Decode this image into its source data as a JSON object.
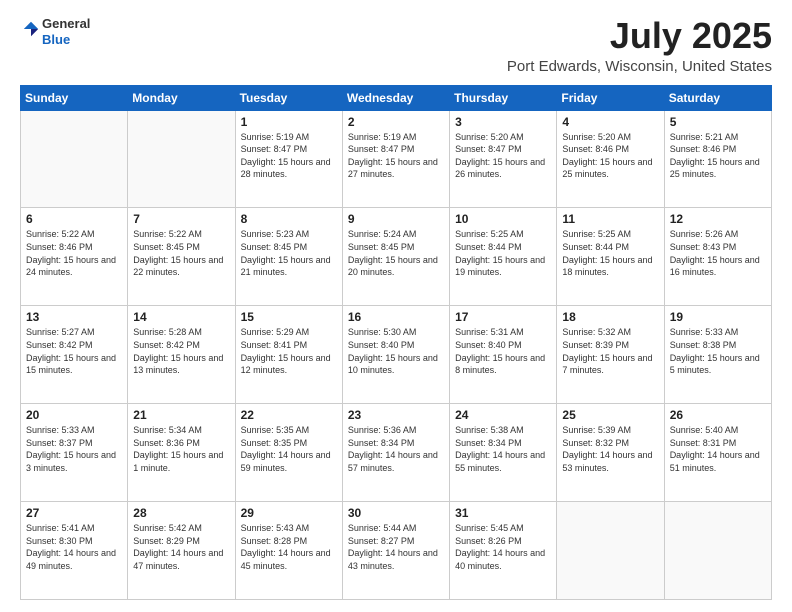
{
  "header": {
    "logo_line1": "General",
    "logo_line2": "Blue",
    "title": "July 2025",
    "subtitle": "Port Edwards, Wisconsin, United States"
  },
  "days_of_week": [
    "Sunday",
    "Monday",
    "Tuesday",
    "Wednesday",
    "Thursday",
    "Friday",
    "Saturday"
  ],
  "weeks": [
    [
      {
        "num": "",
        "info": ""
      },
      {
        "num": "",
        "info": ""
      },
      {
        "num": "1",
        "info": "Sunrise: 5:19 AM\nSunset: 8:47 PM\nDaylight: 15 hours and 28 minutes."
      },
      {
        "num": "2",
        "info": "Sunrise: 5:19 AM\nSunset: 8:47 PM\nDaylight: 15 hours and 27 minutes."
      },
      {
        "num": "3",
        "info": "Sunrise: 5:20 AM\nSunset: 8:47 PM\nDaylight: 15 hours and 26 minutes."
      },
      {
        "num": "4",
        "info": "Sunrise: 5:20 AM\nSunset: 8:46 PM\nDaylight: 15 hours and 25 minutes."
      },
      {
        "num": "5",
        "info": "Sunrise: 5:21 AM\nSunset: 8:46 PM\nDaylight: 15 hours and 25 minutes."
      }
    ],
    [
      {
        "num": "6",
        "info": "Sunrise: 5:22 AM\nSunset: 8:46 PM\nDaylight: 15 hours and 24 minutes."
      },
      {
        "num": "7",
        "info": "Sunrise: 5:22 AM\nSunset: 8:45 PM\nDaylight: 15 hours and 22 minutes."
      },
      {
        "num": "8",
        "info": "Sunrise: 5:23 AM\nSunset: 8:45 PM\nDaylight: 15 hours and 21 minutes."
      },
      {
        "num": "9",
        "info": "Sunrise: 5:24 AM\nSunset: 8:45 PM\nDaylight: 15 hours and 20 minutes."
      },
      {
        "num": "10",
        "info": "Sunrise: 5:25 AM\nSunset: 8:44 PM\nDaylight: 15 hours and 19 minutes."
      },
      {
        "num": "11",
        "info": "Sunrise: 5:25 AM\nSunset: 8:44 PM\nDaylight: 15 hours and 18 minutes."
      },
      {
        "num": "12",
        "info": "Sunrise: 5:26 AM\nSunset: 8:43 PM\nDaylight: 15 hours and 16 minutes."
      }
    ],
    [
      {
        "num": "13",
        "info": "Sunrise: 5:27 AM\nSunset: 8:42 PM\nDaylight: 15 hours and 15 minutes."
      },
      {
        "num": "14",
        "info": "Sunrise: 5:28 AM\nSunset: 8:42 PM\nDaylight: 15 hours and 13 minutes."
      },
      {
        "num": "15",
        "info": "Sunrise: 5:29 AM\nSunset: 8:41 PM\nDaylight: 15 hours and 12 minutes."
      },
      {
        "num": "16",
        "info": "Sunrise: 5:30 AM\nSunset: 8:40 PM\nDaylight: 15 hours and 10 minutes."
      },
      {
        "num": "17",
        "info": "Sunrise: 5:31 AM\nSunset: 8:40 PM\nDaylight: 15 hours and 8 minutes."
      },
      {
        "num": "18",
        "info": "Sunrise: 5:32 AM\nSunset: 8:39 PM\nDaylight: 15 hours and 7 minutes."
      },
      {
        "num": "19",
        "info": "Sunrise: 5:33 AM\nSunset: 8:38 PM\nDaylight: 15 hours and 5 minutes."
      }
    ],
    [
      {
        "num": "20",
        "info": "Sunrise: 5:33 AM\nSunset: 8:37 PM\nDaylight: 15 hours and 3 minutes."
      },
      {
        "num": "21",
        "info": "Sunrise: 5:34 AM\nSunset: 8:36 PM\nDaylight: 15 hours and 1 minute."
      },
      {
        "num": "22",
        "info": "Sunrise: 5:35 AM\nSunset: 8:35 PM\nDaylight: 14 hours and 59 minutes."
      },
      {
        "num": "23",
        "info": "Sunrise: 5:36 AM\nSunset: 8:34 PM\nDaylight: 14 hours and 57 minutes."
      },
      {
        "num": "24",
        "info": "Sunrise: 5:38 AM\nSunset: 8:34 PM\nDaylight: 14 hours and 55 minutes."
      },
      {
        "num": "25",
        "info": "Sunrise: 5:39 AM\nSunset: 8:32 PM\nDaylight: 14 hours and 53 minutes."
      },
      {
        "num": "26",
        "info": "Sunrise: 5:40 AM\nSunset: 8:31 PM\nDaylight: 14 hours and 51 minutes."
      }
    ],
    [
      {
        "num": "27",
        "info": "Sunrise: 5:41 AM\nSunset: 8:30 PM\nDaylight: 14 hours and 49 minutes."
      },
      {
        "num": "28",
        "info": "Sunrise: 5:42 AM\nSunset: 8:29 PM\nDaylight: 14 hours and 47 minutes."
      },
      {
        "num": "29",
        "info": "Sunrise: 5:43 AM\nSunset: 8:28 PM\nDaylight: 14 hours and 45 minutes."
      },
      {
        "num": "30",
        "info": "Sunrise: 5:44 AM\nSunset: 8:27 PM\nDaylight: 14 hours and 43 minutes."
      },
      {
        "num": "31",
        "info": "Sunrise: 5:45 AM\nSunset: 8:26 PM\nDaylight: 14 hours and 40 minutes."
      },
      {
        "num": "",
        "info": ""
      },
      {
        "num": "",
        "info": ""
      }
    ]
  ]
}
